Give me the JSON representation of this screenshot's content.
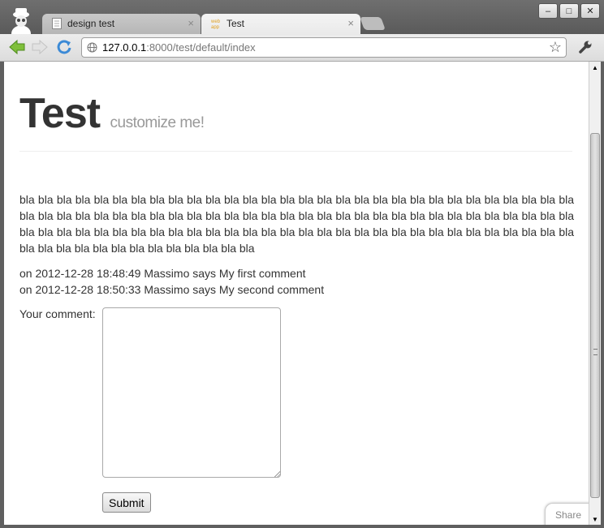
{
  "browser": {
    "tabs": [
      {
        "title": "design test",
        "close": "×"
      },
      {
        "title": "Test",
        "close": "×"
      }
    ],
    "window_buttons": {
      "minimize": "–",
      "maximize": "□",
      "close": "✕"
    },
    "address": {
      "host": "127.0.0.1",
      "rest": ":8000/test/default/index"
    },
    "star": "☆"
  },
  "page": {
    "title": "Test",
    "subtitle": "customize me!",
    "paragraph": "bla bla bla bla bla bla bla bla bla bla bla bla bla bla bla bla bla bla bla bla bla bla bla bla bla bla bla bla bla bla bla bla bla bla bla bla bla bla bla bla bla bla bla bla bla bla bla bla bla bla bla bla bla bla bla bla bla bla bla bla bla bla bla bla bla bla bla bla bla bla bla bla bla bla bla bla bla bla bla bla bla bla bla bla bla bla bla bla bla bla bla bla bla bla bla bla bla bla bla bla bla bla bla",
    "comments": [
      "on 2012-12-28 18:48:49 Massimo says My first comment",
      "on 2012-12-28 18:50:33 Massimo says My second comment"
    ],
    "form": {
      "label": "Your comment:",
      "comment_value": "",
      "submit": "Submit"
    },
    "share": "Share"
  },
  "scrollbar": {
    "up": "▲",
    "down": "▼"
  }
}
